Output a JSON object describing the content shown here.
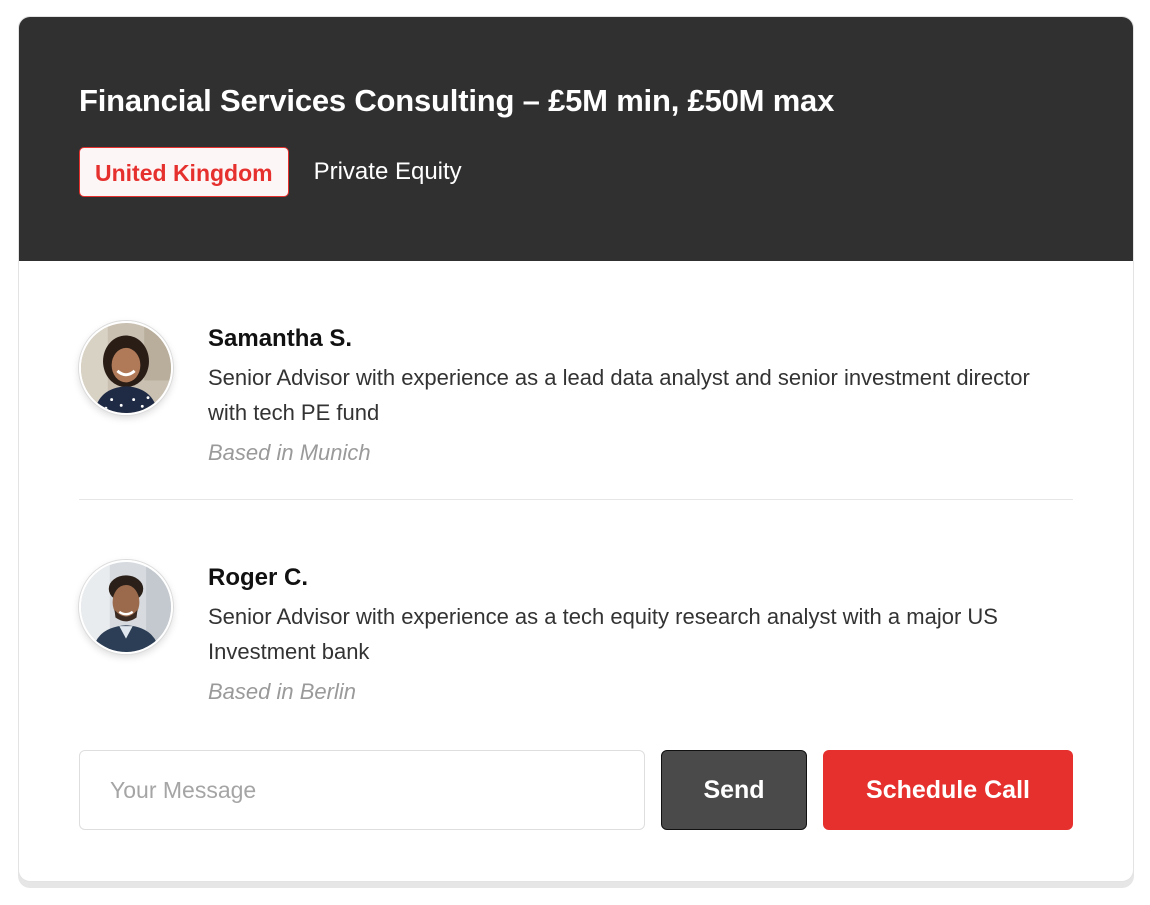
{
  "listing": {
    "title": "Financial Services Consulting – £5M min, £50M max",
    "tags": {
      "country": "United Kingdom",
      "sector": "Private Equity"
    },
    "accent_color": "#e5302e",
    "header_color": "#303030"
  },
  "advisors": [
    {
      "name": "Samantha S.",
      "description": "Senior Advisor with experience as a lead data analyst and senior investment director with tech PE fund",
      "location": "Based in Munich",
      "avatar_icon": "avatar-photo-woman"
    },
    {
      "name": "Roger C.",
      "description": "Senior Advisor with experience as a tech equity research analyst with a major US Investment bank",
      "location": "Based in Berlin",
      "avatar_icon": "avatar-photo-man"
    }
  ],
  "actions": {
    "message_placeholder": "Your Message",
    "message_value": "",
    "send_label": "Send",
    "schedule_label": "Schedule Call"
  }
}
